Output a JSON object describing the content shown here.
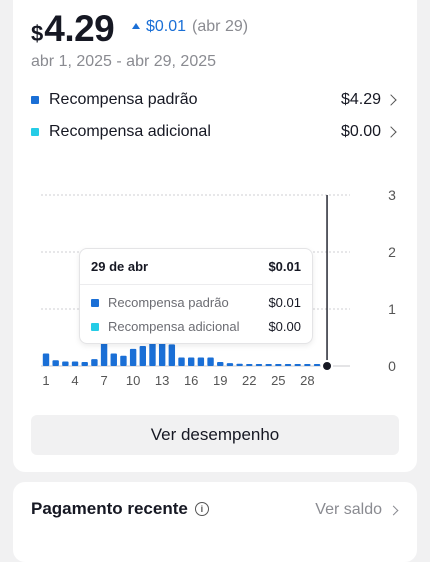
{
  "summary": {
    "currency_symbol": "$",
    "amount": "4.29",
    "delta": "$0.01",
    "delta_date": "(abr 29)",
    "date_range": "abr 1, 2025 - abr 29, 2025"
  },
  "rows": [
    {
      "label": "Recompensa padrão",
      "value": "$4.29",
      "color": "#1a6fd6"
    },
    {
      "label": "Recompensa adicional",
      "value": "$0.00",
      "color": "#25cce6"
    }
  ],
  "chart_data": {
    "type": "bar",
    "categories": [
      1,
      2,
      3,
      4,
      5,
      6,
      7,
      8,
      9,
      10,
      11,
      12,
      13,
      14,
      15,
      16,
      17,
      18,
      19,
      20,
      21,
      22,
      23,
      24,
      25,
      26,
      27,
      28,
      29
    ],
    "x_tick_labels": [
      "1",
      "4",
      "7",
      "10",
      "13",
      "16",
      "19",
      "22",
      "25",
      "28"
    ],
    "y_tick_labels": [
      "0",
      "1",
      "2",
      "3"
    ],
    "ylim": [
      0,
      3
    ],
    "series": [
      {
        "name": "Recompensa padrão",
        "color": "#1a6fd6",
        "values": [
          0.22,
          0.1,
          0.08,
          0.08,
          0.07,
          0.12,
          0.42,
          0.22,
          0.18,
          0.3,
          0.35,
          0.42,
          0.42,
          0.38,
          0.15,
          0.15,
          0.15,
          0.15,
          0.07,
          0.05,
          0.04,
          0.03,
          0.02,
          0.02,
          0.02,
          0.02,
          0.02,
          0.02,
          0.01
        ]
      },
      {
        "name": "Recompensa adicional",
        "color": "#25cce6",
        "values": [
          0,
          0,
          0,
          0,
          0,
          0,
          0,
          0,
          0,
          0,
          0,
          0,
          0,
          0,
          0,
          0,
          0,
          0,
          0,
          0,
          0,
          0,
          0,
          0,
          0,
          0,
          0,
          0,
          0
        ]
      }
    ],
    "grid": true,
    "selected_index": 28
  },
  "tooltip": {
    "date": "29 de abr",
    "total": "$0.01",
    "rows": [
      {
        "label": "Recompensa padrão",
        "value": "$0.01",
        "color": "#1a6fd6"
      },
      {
        "label": "Recompensa adicional",
        "value": "$0.00",
        "color": "#25cce6"
      }
    ]
  },
  "button_label": "Ver desempenho",
  "recent": {
    "title": "Pagamento recente",
    "info_icon": "info-icon",
    "link_label": "Ver saldo"
  }
}
